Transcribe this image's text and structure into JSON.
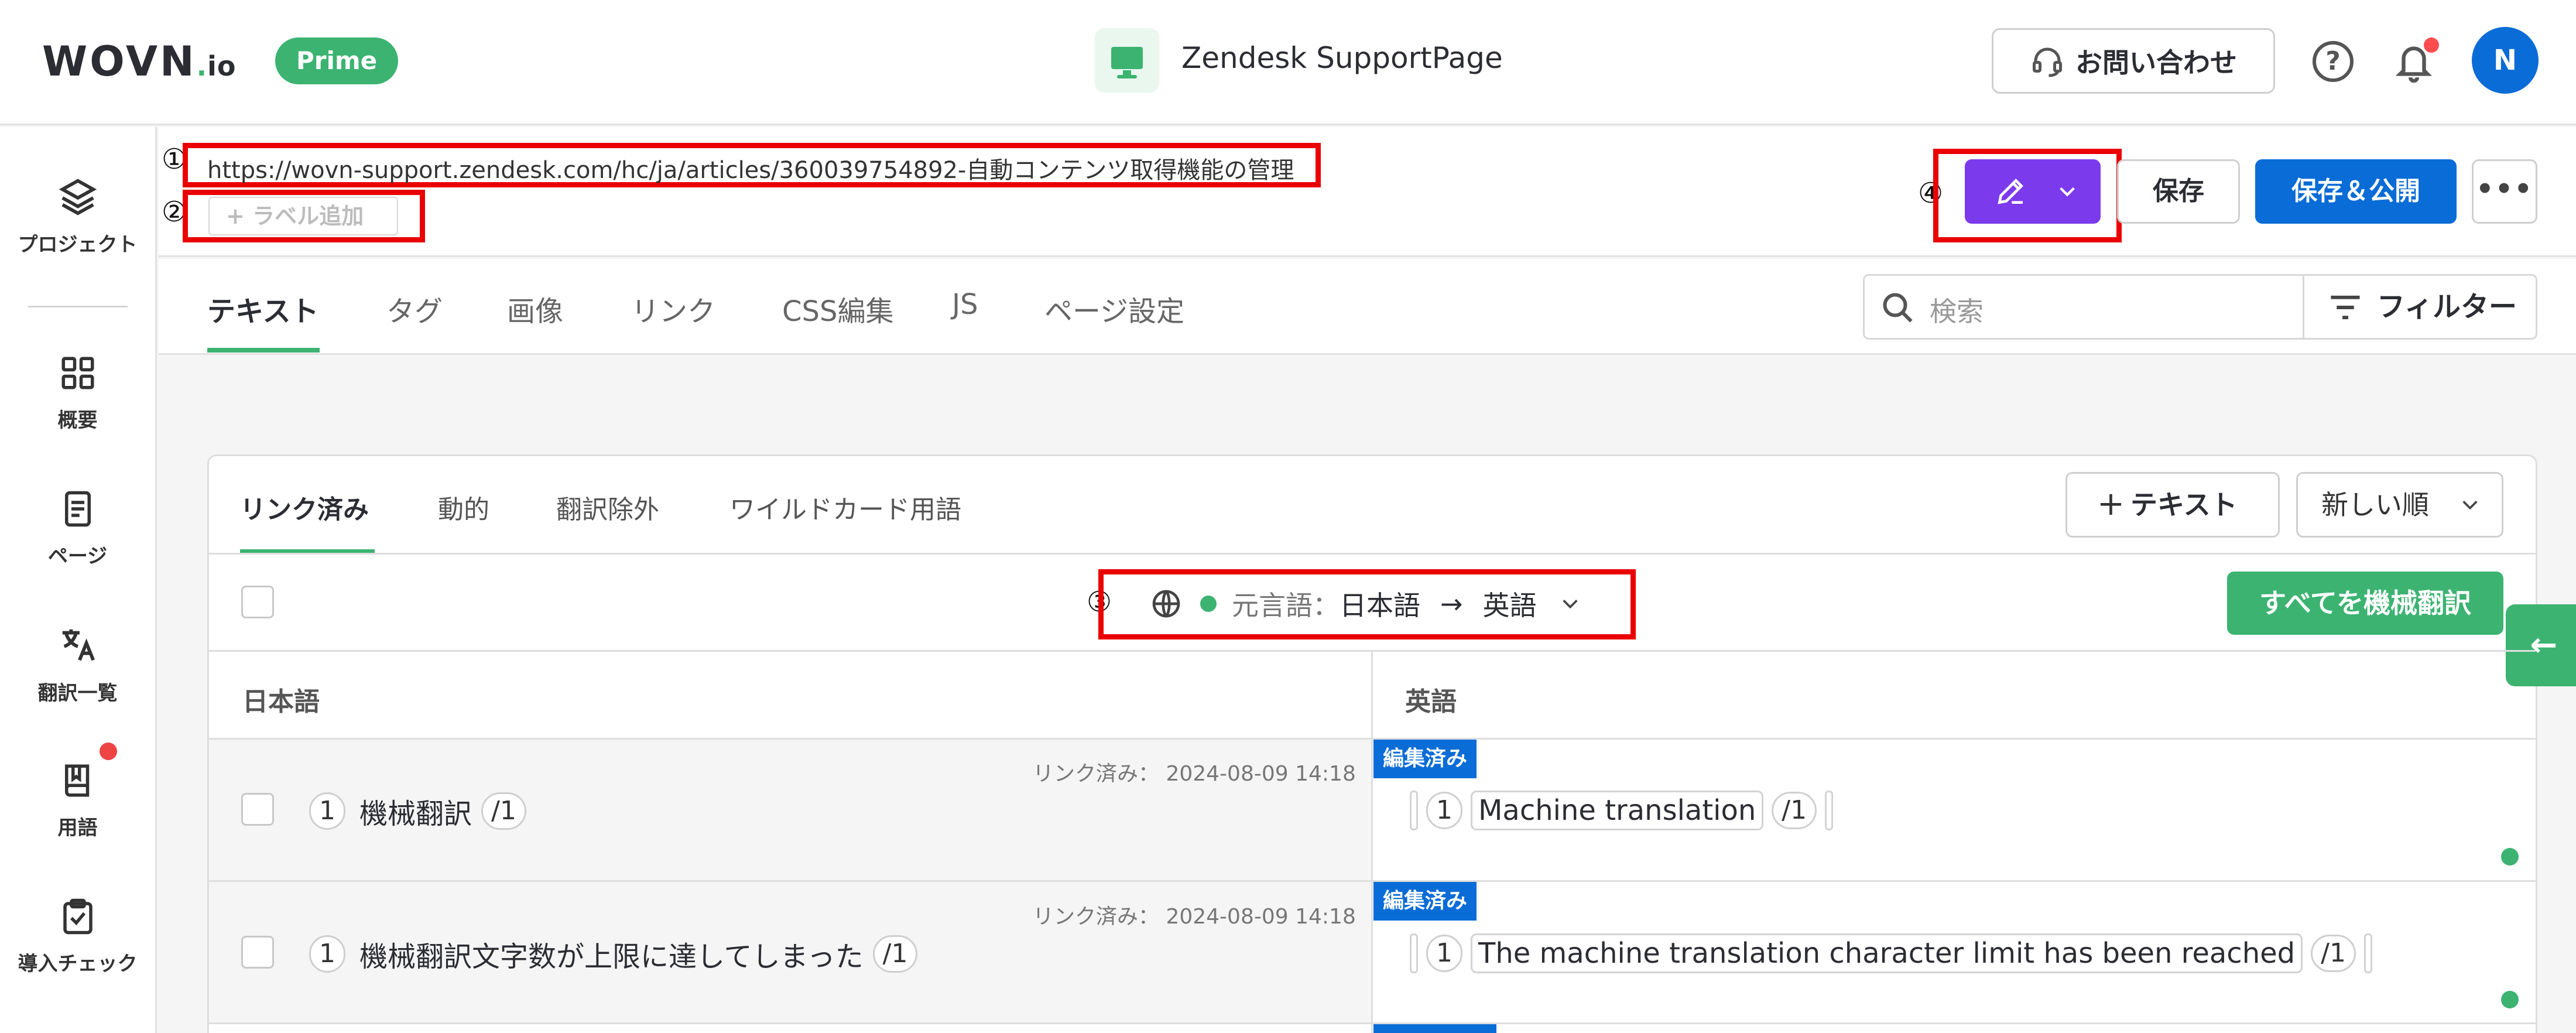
{
  "header": {
    "logo_main": "WOVN",
    "logo_suffix": "io",
    "plan_badge": "Prime",
    "project_name": "Zendesk SupportPage",
    "contact_label": "お問い合わせ",
    "avatar_initial": "N"
  },
  "sidenav": {
    "items": [
      {
        "label": "プロジェクト",
        "icon": "layers-icon"
      },
      {
        "label": "概要",
        "icon": "grid-icon"
      },
      {
        "label": "ページ",
        "icon": "document-icon"
      },
      {
        "label": "翻訳一覧",
        "icon": "translate-icon"
      },
      {
        "label": "用語",
        "icon": "book-icon"
      },
      {
        "label": "導入チェック",
        "icon": "clipboard-check-icon"
      }
    ]
  },
  "pagebar": {
    "url": "https://wovn-support.zendesk.com/hc/ja/articles/360039754892-自動コンテンツ取得機能の管理",
    "add_label": "+ ラベル追加",
    "save_label": "保存",
    "publish_label": "保存＆公開",
    "more_label": "•••"
  },
  "annotations": [
    "①",
    "②",
    "③",
    "④"
  ],
  "tabs": [
    "テキスト",
    "タグ",
    "画像",
    "リンク",
    "CSS編集",
    "JS",
    "ページ設定"
  ],
  "search": {
    "placeholder": "検索",
    "filter_label": "フィルター"
  },
  "subtabs": [
    "リンク済み",
    "動的",
    "翻訳除外",
    "ワイルドカード用語"
  ],
  "toolbar": {
    "add_text_label": "テキスト",
    "sort_label": "新しい順",
    "source_lang_prefix": "元言語：",
    "source_lang": "日本語",
    "arrow": "→",
    "target_lang": "英語",
    "machine_translate_all": "すべてを機械翻訳"
  },
  "columns": {
    "source": "日本語",
    "target": "英語"
  },
  "rows": [
    {
      "linked_meta": "リンク済み： 2024-08-09 14:18",
      "num": "1",
      "source_text": "機械翻訳",
      "close_tag": "/1",
      "badge": "編集済み",
      "target_text": "Machine translation"
    },
    {
      "linked_meta": "リンク済み： 2024-08-09 14:18",
      "num": "1",
      "source_text": "機械翻訳文字数が上限に達してしまった",
      "close_tag": "/1",
      "badge": "編集済み",
      "target_text": "The machine translation character limit has been reached"
    }
  ],
  "colors": {
    "brand_green": "#3cb371",
    "primary_blue": "#0a6cd6",
    "edit_purple": "#7c3aed",
    "annotation_red": "#ea0000"
  }
}
